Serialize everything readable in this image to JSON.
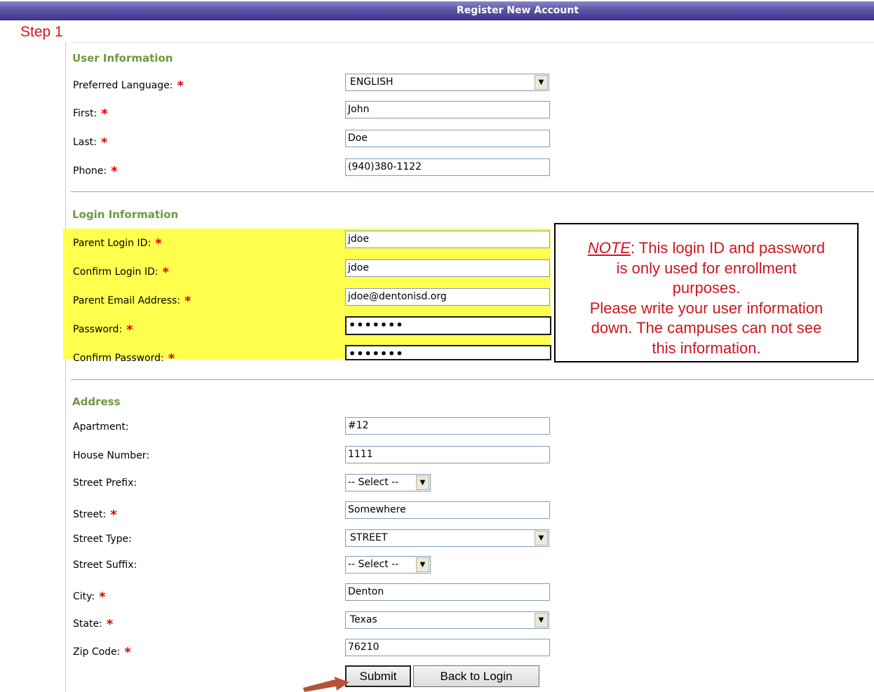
{
  "header": {
    "title": "Register New Account"
  },
  "step_label": "Step 1",
  "sections": {
    "user_info": {
      "title": "User Information"
    },
    "login_info": {
      "title": "Login Information"
    },
    "address": {
      "title": "Address"
    }
  },
  "required_mark": "*",
  "fields": {
    "preferred_language": {
      "label": "Preferred Language:",
      "value": "ENGLISH"
    },
    "first": {
      "label": "First:",
      "value": "John"
    },
    "last": {
      "label": "Last:",
      "value": "Doe"
    },
    "phone": {
      "label": "Phone:",
      "value": "(940)380-1122"
    },
    "parent_login_id": {
      "label": "Parent Login ID:",
      "value": "jdoe"
    },
    "confirm_login_id": {
      "label": "Confirm Login ID:",
      "value": "jdoe"
    },
    "parent_email": {
      "label": "Parent Email Address:",
      "value": "jdoe@dentonisd.org"
    },
    "password": {
      "label": "Password:",
      "value": "•••••••"
    },
    "confirm_password": {
      "label": "Confirm Password:",
      "value": "•••••••"
    },
    "apartment": {
      "label": "Apartment:",
      "value": "#12"
    },
    "house_number": {
      "label": "House Number:",
      "value": "1111"
    },
    "street_prefix": {
      "label": "Street Prefix:",
      "value": "-- Select --"
    },
    "street": {
      "label": "Street:",
      "value": "Somewhere"
    },
    "street_type": {
      "label": "Street Type:",
      "value": "STREET"
    },
    "street_suffix": {
      "label": "Street Suffix:",
      "value": "-- Select --"
    },
    "city": {
      "label": "City:",
      "value": "Denton"
    },
    "state": {
      "label": "State:",
      "value": "Texas"
    },
    "zip": {
      "label": "Zip Code:",
      "value": "76210"
    }
  },
  "note": {
    "label": "NOTE",
    "line1": ": This login ID and password",
    "line2": "is only used for enrollment",
    "line3": "purposes.",
    "line4": "Please write your user information",
    "line5": "down. The campuses can not see",
    "line6": "this information."
  },
  "buttons": {
    "submit": "Submit",
    "back": "Back to Login"
  },
  "icons": {
    "dropdown": "chevron-down-icon",
    "annotation_arrow": "arrow-icon"
  },
  "colors": {
    "header": "#5e56a8",
    "section_title": "#6e9a3f",
    "required": "#e00000",
    "highlight": "#ffff4d",
    "note_text": "#d0141e"
  }
}
